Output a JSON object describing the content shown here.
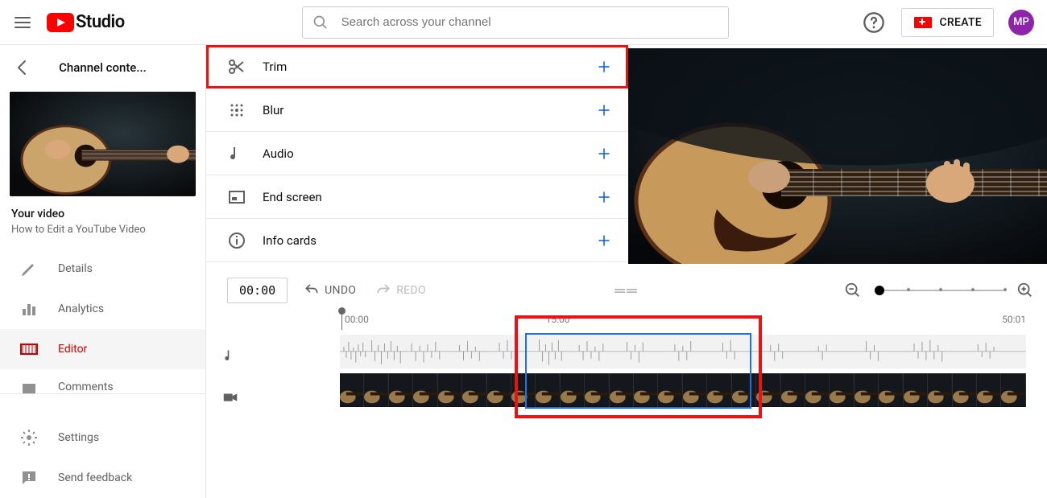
{
  "header": {
    "logo_text": "Studio",
    "search_placeholder": "Search across your channel",
    "create_label": "CREATE",
    "avatar_initials": "MP"
  },
  "sidebar": {
    "breadcrumb": "Channel conte...",
    "video_label": "Your video",
    "video_title": "How to Edit a YouTube Video",
    "items": [
      {
        "label": "Details"
      },
      {
        "label": "Analytics"
      },
      {
        "label": "Editor"
      },
      {
        "label": "Comments"
      }
    ],
    "bottom": [
      {
        "label": "Settings"
      },
      {
        "label": "Send feedback"
      }
    ]
  },
  "tools": [
    {
      "key": "trim",
      "label": "Trim",
      "highlight": true
    },
    {
      "key": "blur",
      "label": "Blur",
      "highlight": false
    },
    {
      "key": "audio",
      "label": "Audio",
      "highlight": false
    },
    {
      "key": "endscreen",
      "label": "End screen",
      "highlight": false
    },
    {
      "key": "infocards",
      "label": "Info cards",
      "highlight": false
    }
  ],
  "timeline": {
    "current_time": "00:00",
    "undo_label": "UNDO",
    "redo_label": "REDO",
    "ruler": {
      "start": "00:00",
      "mid": "15:00",
      "end": "50:01"
    }
  }
}
